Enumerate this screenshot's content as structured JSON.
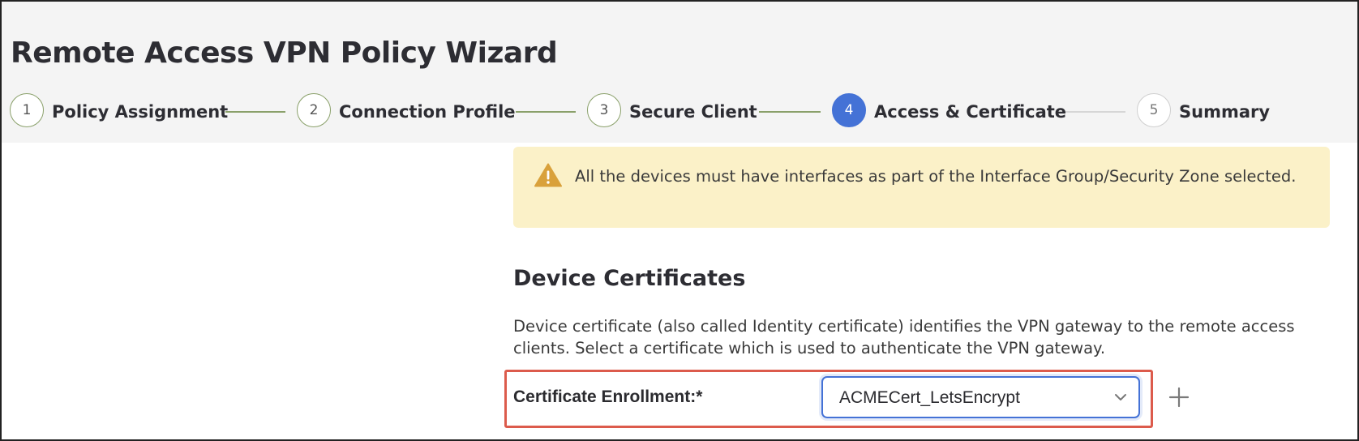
{
  "wizard": {
    "title": "Remote Access VPN Policy Wizard",
    "steps": [
      {
        "number": "1",
        "label": "Policy Assignment",
        "state": "done"
      },
      {
        "number": "2",
        "label": "Connection Profile",
        "state": "done"
      },
      {
        "number": "3",
        "label": "Secure Client",
        "state": "done"
      },
      {
        "number": "4",
        "label": "Access & Certificate",
        "state": "active"
      },
      {
        "number": "5",
        "label": "Summary",
        "state": "pending"
      }
    ]
  },
  "alert": {
    "icon": "warning-icon",
    "text": "All the devices must have interfaces as part of the Interface Group/Security Zone selected."
  },
  "device_certificates": {
    "title": "Device Certificates",
    "description": "Device certificate (also called Identity certificate) identifies the VPN gateway to the remote access clients. Select a certificate which is used to authenticate the VPN gateway.",
    "enrollment_label": "Certificate Enrollment:*",
    "enrollment_value": "ACMECert_LetsEncrypt",
    "add_icon": "plus-icon"
  },
  "colors": {
    "active_step": "#4472d6",
    "completed_step_border": "#8aa06a",
    "alert_background": "#fbf1c8",
    "warning_icon": "#d9a13b",
    "highlight_border": "#dc5b4c",
    "select_border": "#4472d6"
  }
}
